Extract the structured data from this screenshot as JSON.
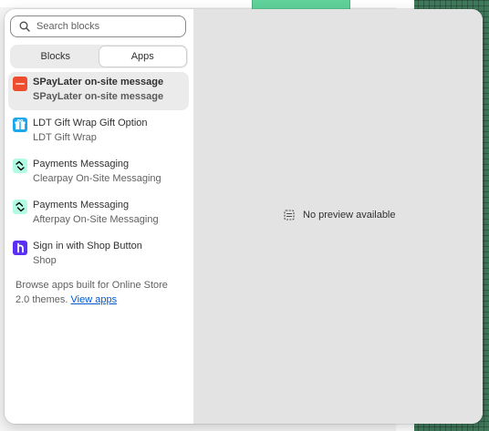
{
  "search": {
    "placeholder": "Search blocks"
  },
  "tabs": [
    {
      "label": "Blocks",
      "active": false
    },
    {
      "label": "Apps",
      "active": true
    }
  ],
  "apps": [
    {
      "title": "SPayLater on-site message",
      "subtitle": "SPayLater on-site message",
      "icon": "spaylater-logo-icon",
      "icon_color": "#ee4d2d",
      "selected": true
    },
    {
      "title": "LDT Gift Wrap Gift Option",
      "subtitle": "LDT Gift Wrap",
      "icon": "gift-icon",
      "icon_color": "#1aa7ec",
      "selected": false
    },
    {
      "title": "Payments Messaging",
      "subtitle": "Clearpay On-Site Messaging",
      "icon": "clearpay-icon",
      "icon_color": "#b2fce4",
      "selected": false
    },
    {
      "title": "Payments Messaging",
      "subtitle": "Afterpay On-Site Messaging",
      "icon": "afterpay-icon",
      "icon_color": "#b2fce4",
      "selected": false
    },
    {
      "title": "Sign in with Shop Button",
      "subtitle": "Shop",
      "icon": "shop-icon",
      "icon_color": "#5a31f4",
      "selected": false
    }
  ],
  "browse": {
    "text": "Browse apps built for Online Store 2.0 themes.",
    "link": "View apps"
  },
  "preview": {
    "empty_text": "No preview available",
    "icon": "no-preview-icon"
  }
}
